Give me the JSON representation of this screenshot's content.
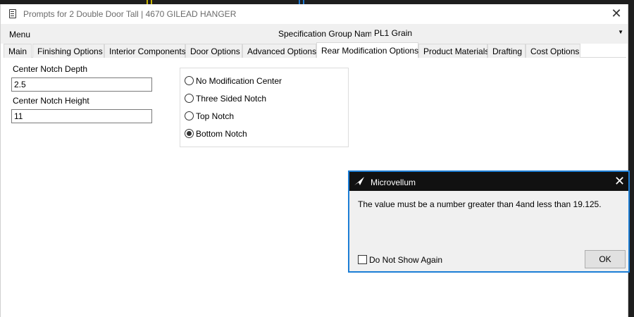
{
  "window": {
    "title": "Prompts for 2 Double Door Tall | 4670 GILEAD HANGER",
    "icon": "form-icon"
  },
  "menubar": {
    "menu_label": "Menu",
    "spec_group_label": "Specification Group Name",
    "spec_group_value": "PL1 Grain"
  },
  "tabs": [
    {
      "label": "Main"
    },
    {
      "label": "Finishing Options"
    },
    {
      "label": "Interior Components"
    },
    {
      "label": "Door Options"
    },
    {
      "label": "Advanced Options"
    },
    {
      "label": "Rear Modification Options",
      "active": true
    },
    {
      "label": "Product Materials"
    },
    {
      "label": "Drafting"
    },
    {
      "label": "Cost Options"
    }
  ],
  "fields": {
    "center_notch_depth_label": "Center Notch Depth",
    "center_notch_depth_value": "2.5",
    "center_notch_height_label": "Center Notch Height",
    "center_notch_height_value": "11"
  },
  "radio_options": [
    {
      "label": "No Modification Center",
      "checked": false
    },
    {
      "label": "Three Sided Notch",
      "checked": false
    },
    {
      "label": "Top Notch",
      "checked": false
    },
    {
      "label": "Bottom Notch",
      "checked": true
    }
  ],
  "dialog": {
    "title": "Microvellum",
    "message": "The value must be a number greater than 4and less than 19.125.",
    "checkbox_label": "Do Not Show Again",
    "ok_label": "OK",
    "accent_color": "#1c7ed6"
  }
}
